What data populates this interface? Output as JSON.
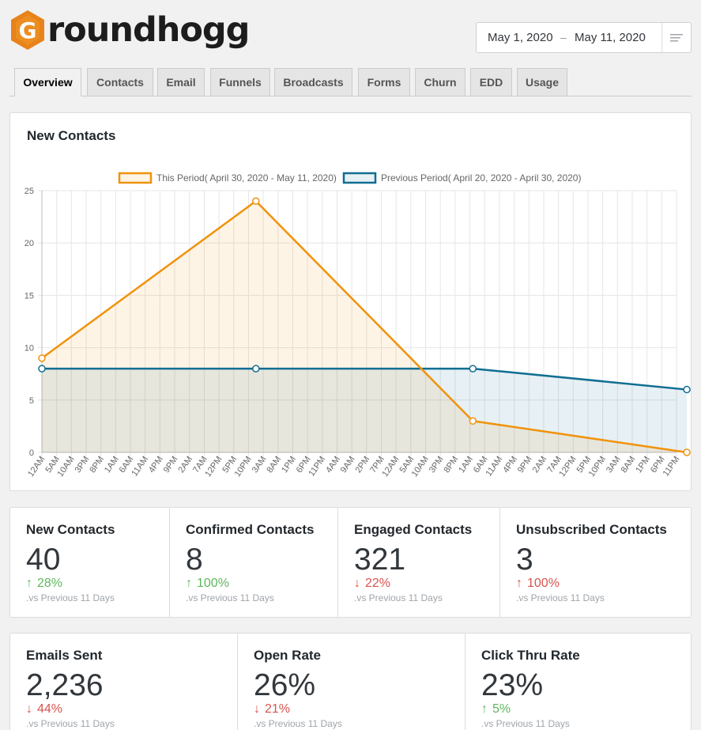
{
  "header": {
    "logo_text": "roundhogg",
    "logo_letter": "G",
    "brand_color": "#e8821a"
  },
  "date_range": {
    "start": "May 1, 2020",
    "separator": "–",
    "end": "May 11, 2020",
    "menu_icon": "menu-lines-icon"
  },
  "tabs": [
    {
      "label": "Overview",
      "active": true
    },
    {
      "label": "Contacts"
    },
    {
      "label": "Email"
    },
    {
      "label": "Funnels"
    },
    {
      "label": "Broadcasts"
    },
    {
      "label": "Forms"
    },
    {
      "label": "Churn"
    },
    {
      "label": "EDD"
    },
    {
      "label": "Usage"
    }
  ],
  "chart_card": {
    "title": "New Contacts"
  },
  "chart_data": {
    "type": "line",
    "title": "New Contacts",
    "legend_position": "top",
    "grid": true,
    "ylim": [
      0,
      25
    ],
    "y_ticks": [
      0,
      5,
      10,
      15,
      20,
      25
    ],
    "x_tick_labels": [
      "12AM",
      "5AM",
      "10AM",
      "3PM",
      "8PM",
      "1AM",
      "6AM",
      "11AM",
      "4PM",
      "9PM",
      "2AM",
      "7AM",
      "12PM",
      "5PM",
      "10PM",
      "3AM",
      "8AM",
      "1PM",
      "6PM",
      "11PM",
      "4AM",
      "9AM",
      "2PM",
      "7PM",
      "12AM",
      "5AM",
      "10AM",
      "3PM",
      "8PM",
      "1AM",
      "6AM",
      "11AM",
      "4PM",
      "9PM",
      "2AM",
      "7AM",
      "12PM",
      "5PM",
      "10PM",
      "3AM",
      "8AM",
      "1PM",
      "6PM",
      "11PM"
    ],
    "series": [
      {
        "name": "This Period( April 30, 2020 - May 11, 2020)",
        "color": "#f0930d",
        "fill": "rgba(240,147,13,0.1)",
        "points": [
          {
            "x_index": 0,
            "y": 9
          },
          {
            "x_index": 14.5,
            "y": 24
          },
          {
            "x_index": 29.2,
            "y": 3
          },
          {
            "x_index": 43.7,
            "y": 0
          }
        ]
      },
      {
        "name": "Previous Period( April 20, 2020 - April 30, 2020)",
        "color": "#0f6e92",
        "fill": "rgba(15,110,146,0.1)",
        "points": [
          {
            "x_index": 0,
            "y": 8
          },
          {
            "x_index": 14.5,
            "y": 8
          },
          {
            "x_index": 29.2,
            "y": 8
          },
          {
            "x_index": 43.7,
            "y": 6
          }
        ]
      }
    ]
  },
  "stats_row1": [
    {
      "title": "New Contacts",
      "value": "40",
      "change": "28%",
      "direction": "up",
      "tone": "green",
      "note": ".vs Previous 11 Days"
    },
    {
      "title": "Confirmed Contacts",
      "value": "8",
      "change": "100%",
      "direction": "up",
      "tone": "green",
      "note": ".vs Previous 11 Days"
    },
    {
      "title": "Engaged Contacts",
      "value": "321",
      "change": "22%",
      "direction": "down",
      "tone": "red",
      "note": ".vs Previous 11 Days"
    },
    {
      "title": "Unsubscribed Contacts",
      "value": "3",
      "change": "100%",
      "direction": "up",
      "tone": "red",
      "note": ".vs Previous 11 Days"
    }
  ],
  "stats_row2": [
    {
      "title": "Emails Sent",
      "value": "2,236",
      "change": "44%",
      "direction": "down",
      "tone": "red",
      "note": ".vs Previous 11 Days"
    },
    {
      "title": "Open Rate",
      "value": "26%",
      "change": "21%",
      "direction": "down",
      "tone": "red",
      "note": ".vs Previous 11 Days"
    },
    {
      "title": "Click Thru Rate",
      "value": "23%",
      "change": "5%",
      "direction": "up",
      "tone": "green",
      "note": ".vs Previous 11 Days"
    }
  ],
  "arrows": {
    "up": "↑",
    "down": "↓"
  }
}
